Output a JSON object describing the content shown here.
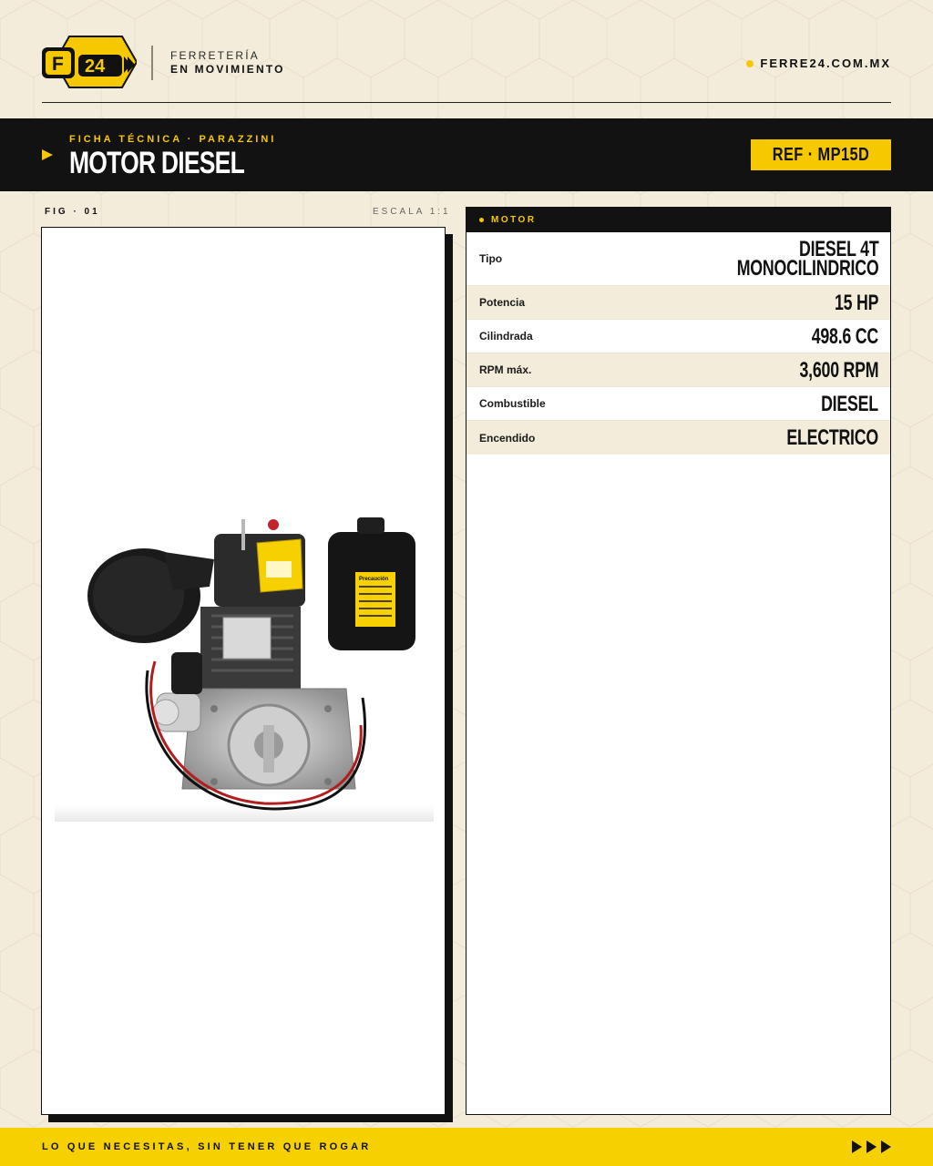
{
  "header": {
    "logo_text": "F 24",
    "brand_line1": "FERRETERÍA",
    "brand_line2": "EN MOVIMIENTO",
    "website": "FERRE24.COM.MX"
  },
  "title_band": {
    "kicker": "FICHA TÉCNICA · PARAZZINI",
    "title": "MOTOR DIESEL",
    "ref": "REF · MP15D"
  },
  "figure": {
    "caption": "FIG · 01",
    "scale": "ESCALA 1:1",
    "image_label": "Precaución"
  },
  "specs": {
    "section": "MOTOR",
    "rows": [
      {
        "label": "Tipo",
        "value_line1": "DIESEL 4T",
        "value_line2": "MONOCILINDRICO"
      },
      {
        "label": "Potencia",
        "value_line1": "15 HP"
      },
      {
        "label": "Cilindrada",
        "value_line1": "498.6 CC"
      },
      {
        "label": "RPM máx.",
        "value_line1": "3,600 RPM"
      },
      {
        "label": "Combustible",
        "value_line1": "DIESEL"
      },
      {
        "label": "Encendido",
        "value_line1": "ELECTRICO"
      }
    ]
  },
  "footer": {
    "slogan": "LO QUE NECESITAS, SIN TENER QUE ROGAR"
  },
  "colors": {
    "accent": "#f6c800",
    "background": "#f3ecdb",
    "dark": "#121212"
  }
}
